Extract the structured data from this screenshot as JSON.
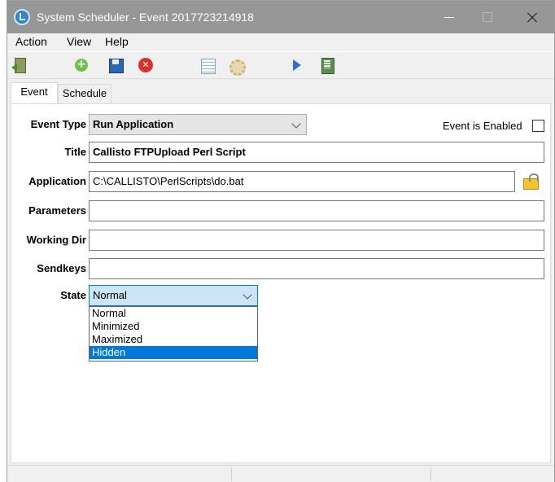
{
  "window": {
    "title": "System Scheduler - Event 2017723214918",
    "icon": "scheduler-app-icon"
  },
  "menu": [
    "Action",
    "View",
    "Help"
  ],
  "toolbar": {
    "icons": [
      "exit-icon",
      "add-icon",
      "save-icon",
      "delete-icon",
      "list-icon",
      "settings-icon",
      "run-icon",
      "document-icon"
    ]
  },
  "tabs": [
    "Event",
    "Schedule"
  ],
  "form": {
    "event_type_label": "Event Type",
    "event_type_value": "Run Application",
    "event_enabled_label": "Event is Enabled",
    "event_enabled_checked": false,
    "title_label": "Title",
    "title_value": "Callisto FTPUpload Perl Script",
    "application_label": "Application",
    "application_value": "C:\\CALLISTO\\PerlScripts\\do.bat",
    "parameters_label": "Parameters",
    "parameters_value": "",
    "working_dir_label": "Working Dir",
    "working_dir_value": "",
    "sendkeys_label": "Sendkeys",
    "sendkeys_value": "",
    "state_label": "State",
    "state_value": "Normal",
    "state_options": [
      "Normal",
      "Minimized",
      "Maximized",
      "Hidden"
    ],
    "state_highlighted": "Hidden"
  },
  "colors": {
    "titlebar": "#979797",
    "selection": "#0078d7",
    "combo_focus": "#cce4f7"
  }
}
